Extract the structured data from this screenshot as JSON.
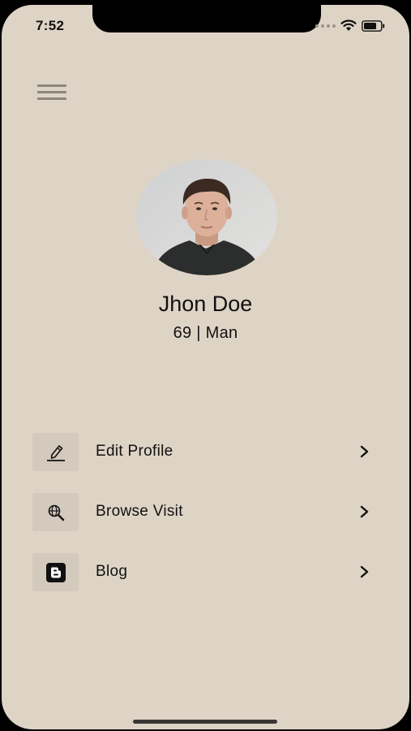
{
  "status_bar": {
    "time": "7:52"
  },
  "profile": {
    "name": "Jhon Doe",
    "details": "69 | Man"
  },
  "menu": [
    {
      "label": "Edit Profile",
      "icon": "pencil-icon"
    },
    {
      "label": "Browse Visit",
      "icon": "globe-search-icon"
    },
    {
      "label": "Blog",
      "icon": "blogger-icon"
    }
  ],
  "colors": {
    "background": "#ded4c6",
    "icon_box": "#d3c9bc",
    "text": "#111111"
  }
}
